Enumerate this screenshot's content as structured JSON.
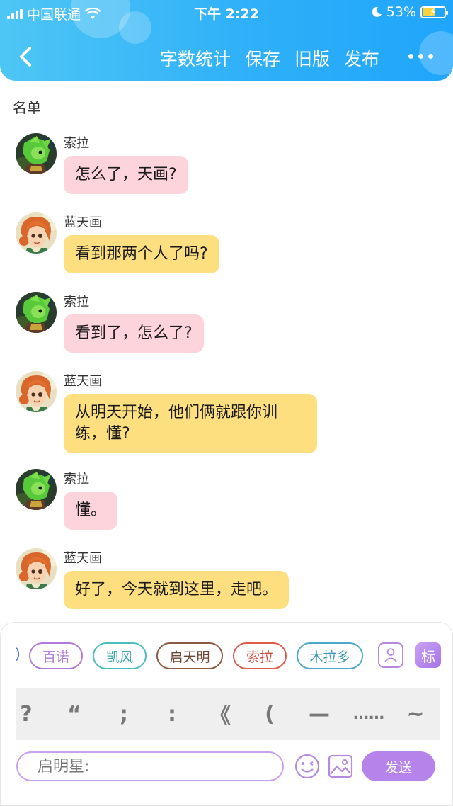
{
  "status_bar": {
    "carrier": "中国联通",
    "time": "下午 2:22",
    "battery_percent": "53%",
    "battery_level": 0.53,
    "battery_color": "#f7d23a"
  },
  "header": {
    "actions": [
      "字数统计",
      "保存",
      "旧版",
      "发布"
    ],
    "background_color": "#2fb0f8"
  },
  "roster_label": "名单",
  "messages": [
    {
      "speaker": "索拉",
      "text": "怎么了，天画?",
      "style": "pink",
      "avatar": "sora-avatar"
    },
    {
      "speaker": "蓝天画",
      "text": "看到那两个人了吗?",
      "style": "yellow",
      "avatar": "tianhua-avatar"
    },
    {
      "speaker": "索拉",
      "text": "看到了，怎么了?",
      "style": "pink",
      "avatar": "sora-avatar"
    },
    {
      "speaker": "蓝天画",
      "text": "从明天开始，他们俩就跟你训练，懂?",
      "style": "yellow",
      "avatar": "tianhua-avatar"
    },
    {
      "speaker": "索拉",
      "text": "懂。",
      "style": "pink",
      "avatar": "sora-avatar"
    },
    {
      "speaker": "蓝天画",
      "text": "好了，今天就到这里，走吧。",
      "style": "yellow",
      "avatar": "tianhua-avatar"
    }
  ],
  "character_chips": [
    {
      "label": "百诺",
      "color": "#b07ad8"
    },
    {
      "label": "凯风",
      "color": "#4bbcbd"
    },
    {
      "label": "启天明",
      "color": "#8b5a42"
    },
    {
      "label": "索拉",
      "color": "#e05a4a"
    },
    {
      "label": "木拉多",
      "color": "#4aa9c9"
    }
  ],
  "tag_label": "标",
  "punctuation": [
    "?",
    "“",
    ";",
    ":",
    "《",
    "(",
    "—",
    "……",
    "~"
  ],
  "input": {
    "placeholder": "启明星:",
    "value": ""
  },
  "send_label": "发送",
  "colors": {
    "pink_bubble": "#fdd3dc",
    "yellow_bubble": "#fedf80",
    "accent_purple": "#b583ea"
  }
}
